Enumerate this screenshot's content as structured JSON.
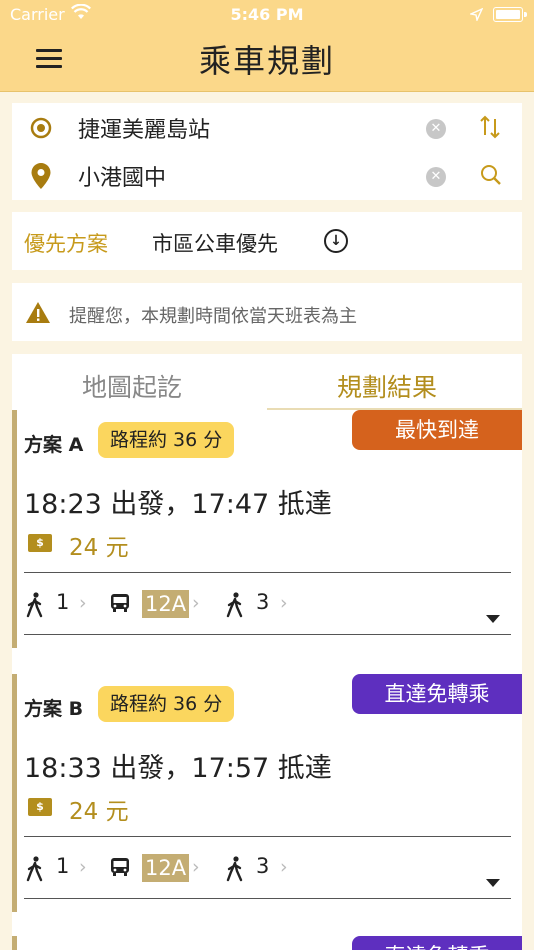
{
  "status_bar": {
    "carrier": "Carrier",
    "time": "5:46 PM"
  },
  "nav": {
    "title": "乘車規劃",
    "menu_icon": "hamburger-icon"
  },
  "trip": {
    "origin": "捷運美麗島站",
    "destination": "小港國中",
    "origin_icon": "origin-target-icon",
    "destination_icon": "map-pin-icon",
    "swap_icon": "swap-arrows-icon",
    "search_icon": "search-icon",
    "clear_icon": "clear-circle-icon"
  },
  "preference": {
    "label": "優先方案",
    "value": "市區公車優先",
    "icon": "download-circle-icon"
  },
  "notice": {
    "icon": "warning-icon",
    "text": "提醒您，本規劃時間依當天班表為主"
  },
  "tabs": [
    {
      "label": "地圖起訖",
      "active": false
    },
    {
      "label": "規劃結果",
      "active": true
    }
  ],
  "plans": [
    {
      "name": "方案 A",
      "duration": "路程約 36 分",
      "badge": "最快到達",
      "badge_color": "#d5621d",
      "times": "18:23 出發，17:47 抵達",
      "fare": "24 元",
      "steps": {
        "walk1": "1",
        "route": "12A",
        "walk2": "3"
      }
    },
    {
      "name": "方案 B",
      "duration": "路程約 36 分",
      "badge": "直達免轉乘",
      "badge_color": "#5e2fbf",
      "times": "18:33 出發，17:57 抵達",
      "fare": "24 元",
      "steps": {
        "walk1": "1",
        "route": "12A",
        "walk2": "3"
      }
    },
    {
      "name": "",
      "duration": "",
      "badge": "直達免轉乘",
      "badge_color": "#5e2fbf"
    }
  ],
  "colors": {
    "accent": "#c79a1b",
    "header": "#fbd88a",
    "duration_pill": "#fbd65e",
    "route_chip": "#c4ad73"
  }
}
